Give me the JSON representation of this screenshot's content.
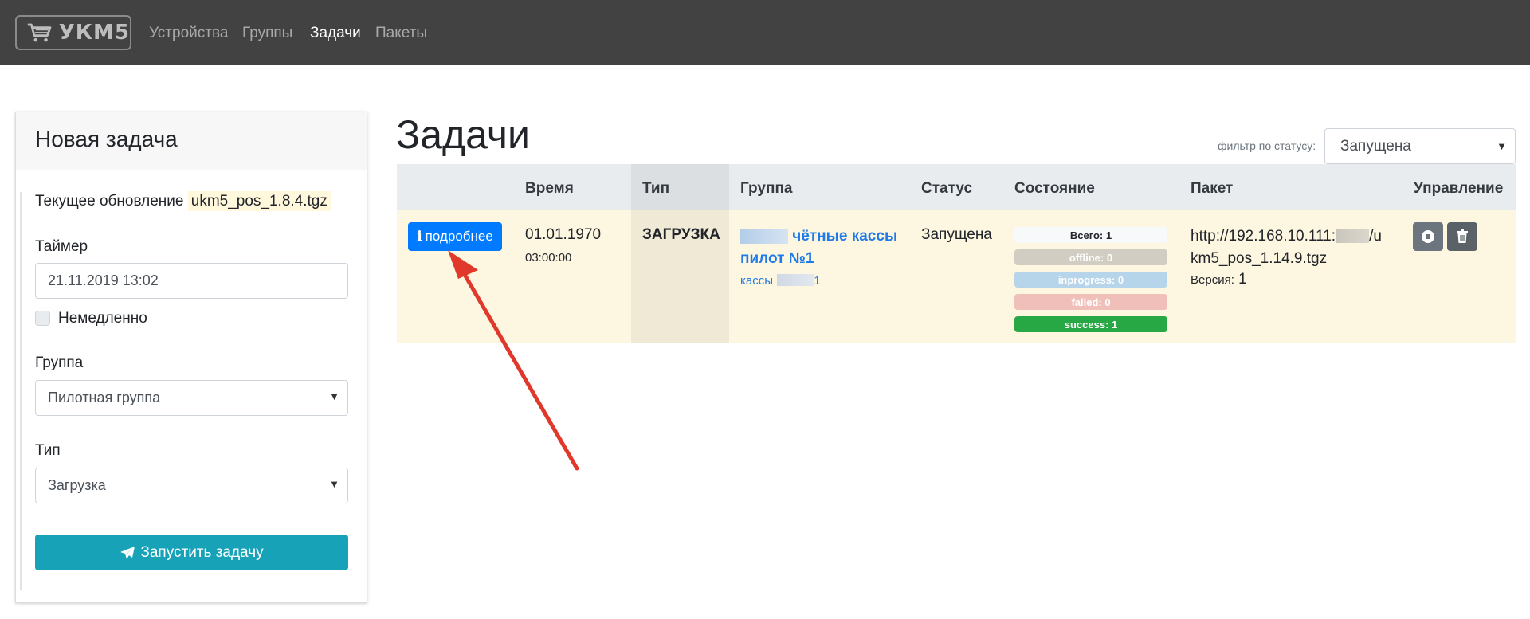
{
  "nav": {
    "brand": "УКМ5",
    "links": [
      "Устройства",
      "Группы",
      "Задачи",
      "Пакеты"
    ],
    "active": "Задачи"
  },
  "new_task": {
    "title": "Новая задача",
    "current_update_label": "Текущее обновление",
    "current_update_file": "ukm5_pos_1.8.4.tgz",
    "timer_label": "Таймер",
    "timer_value": "21.11.2019 13:02",
    "immediately_label": "Немедленно",
    "group_label": "Группа",
    "group_value": "Пилотная группа",
    "type_label": "Тип",
    "type_value": "Загрузка",
    "submit_label": "Запустить задачу"
  },
  "tasks": {
    "title": "Задачи",
    "filter_label": "фильтр по статусу:",
    "filter_value": "Запущена",
    "columns": [
      "Время",
      "Тип",
      "Группа",
      "Статус",
      "Состояние",
      "Пакет",
      "Управление"
    ],
    "row": {
      "details_label": "подробнее",
      "date": "01.01.1970",
      "time": "03:00:00",
      "type": "ЗАГРУЗКА",
      "group_name_part1": "чётные кассы",
      "group_name_part2": "пилот №1",
      "group_sub_prefix": "кассы",
      "group_sub_suffix": "1",
      "status": "Запущена",
      "state": {
        "total": "Всего: 1",
        "offline": "offline: 0",
        "inprogress": "inprogress: 0",
        "failed": "failed: 0",
        "success": "success: 1"
      },
      "package_prefix": "http://192.168.10.111:",
      "package_mid": "/u",
      "package_line2": "km5_pos_1.14.9.tgz",
      "version_label": "Версия:",
      "version_value": "1"
    }
  },
  "colors": {
    "navbar": "#424242",
    "primary": "#007bff",
    "info": "#17a2b8",
    "success": "#28a745",
    "row_highlight": "#fdf6e0",
    "annotation_arrow": "#e0392b"
  }
}
